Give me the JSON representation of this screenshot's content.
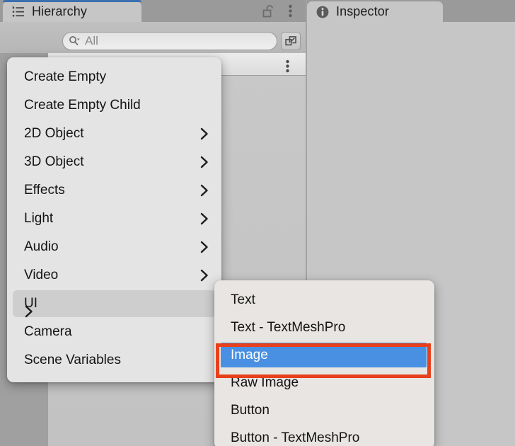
{
  "window": {
    "accent_color": "#3a6fb0",
    "panel_bg": "#c6c6c6"
  },
  "hierarchy_panel": {
    "tab": {
      "label": "Hierarchy",
      "icon": "hierarchy-list-icon",
      "focused": true
    },
    "tools": {
      "lock": "lock-open-icon",
      "menu": "kebab-menu-icon"
    },
    "toolbar": {
      "add_button": "+",
      "add_dropdown_icon": "caret-down-icon",
      "search": {
        "icon": "search-icon",
        "value": "",
        "placeholder": "All"
      },
      "expand_button_icon": "expand-window-icon"
    },
    "background_panel": {
      "menu_icon": "kebab-menu-icon"
    }
  },
  "inspector_panel": {
    "tab": {
      "label": "Inspector",
      "icon": "info-circle-icon",
      "focused": false
    }
  },
  "create_menu": {
    "items": [
      {
        "label": "Create Empty",
        "submenu": false,
        "state": "normal"
      },
      {
        "label": "Create Empty Child",
        "submenu": false,
        "state": "normal"
      },
      {
        "label": "2D Object",
        "submenu": true,
        "state": "normal"
      },
      {
        "label": "3D Object",
        "submenu": true,
        "state": "normal"
      },
      {
        "label": "Effects",
        "submenu": true,
        "state": "normal"
      },
      {
        "label": "Light",
        "submenu": true,
        "state": "normal"
      },
      {
        "label": "Audio",
        "submenu": true,
        "state": "normal"
      },
      {
        "label": "Video",
        "submenu": true,
        "state": "normal"
      },
      {
        "label": "UI",
        "submenu": true,
        "state": "hovered"
      },
      {
        "label": "Camera",
        "submenu": false,
        "state": "normal"
      },
      {
        "label": "Scene Variables",
        "submenu": false,
        "state": "normal"
      }
    ]
  },
  "ui_submenu": {
    "items": [
      {
        "label": "Text",
        "state": "normal"
      },
      {
        "label": "Text - TextMeshPro",
        "state": "normal"
      },
      {
        "label": "Image",
        "state": "selected"
      },
      {
        "label": "Raw Image",
        "state": "normal"
      },
      {
        "label": "Button",
        "state": "normal"
      },
      {
        "label": "Button - TextMeshPro",
        "state": "clipped"
      }
    ],
    "selection_highlight_color": "#4a90e2",
    "annotation_box_color": "#e8401c"
  }
}
